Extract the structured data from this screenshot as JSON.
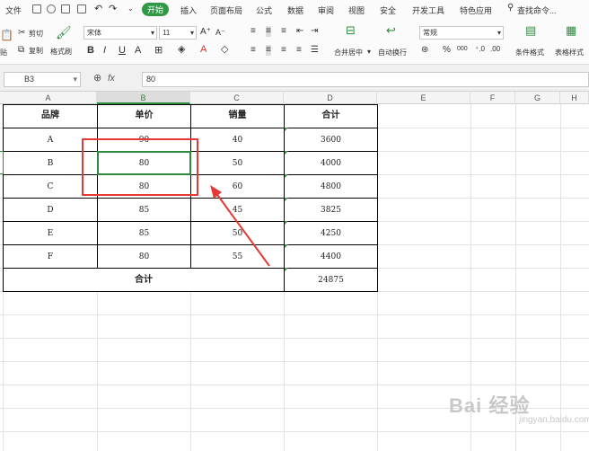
{
  "menubar": {
    "file": "文件",
    "tabs": [
      "开始",
      "插入",
      "页面布局",
      "公式",
      "数据",
      "审阅",
      "视图",
      "安全",
      "开发工具",
      "特色应用"
    ],
    "search": "查找命令..."
  },
  "ribbon": {
    "cut": "剪切",
    "copy": "复制",
    "paste_frag": "贴",
    "format_painter": "格式刷",
    "font_name": "宋体",
    "font_size": "11",
    "merge": "合并居中",
    "wrap": "自动换行",
    "num_format": "常规",
    "cond_format": "条件格式",
    "table_style": "表格样式",
    "bold": "B",
    "italic": "I",
    "underline": "U",
    "percent": "%",
    "thousands": "000"
  },
  "formula_bar": {
    "name_box": "B3",
    "fx": "fx",
    "value": "80"
  },
  "columns": [
    "A",
    "B",
    "C",
    "D",
    "E",
    "F",
    "G",
    "H"
  ],
  "table": {
    "headers": [
      "品牌",
      "单价",
      "销量",
      "合计"
    ],
    "rows": [
      [
        "A",
        "90",
        "40",
        "3600"
      ],
      [
        "B",
        "80",
        "50",
        "4000"
      ],
      [
        "C",
        "80",
        "60",
        "4800"
      ],
      [
        "D",
        "85",
        "45",
        "3825"
      ],
      [
        "E",
        "85",
        "50",
        "4250"
      ],
      [
        "F",
        "80",
        "55",
        "4400"
      ]
    ],
    "total_label": "合计",
    "total_value": "24875"
  },
  "watermark": {
    "text": "Bai 经验",
    "sub": "jingyan.baidu.com"
  },
  "colors": {
    "accent": "#2e9a46",
    "annotation": "#e53935",
    "selection": "#2e8b3e"
  }
}
